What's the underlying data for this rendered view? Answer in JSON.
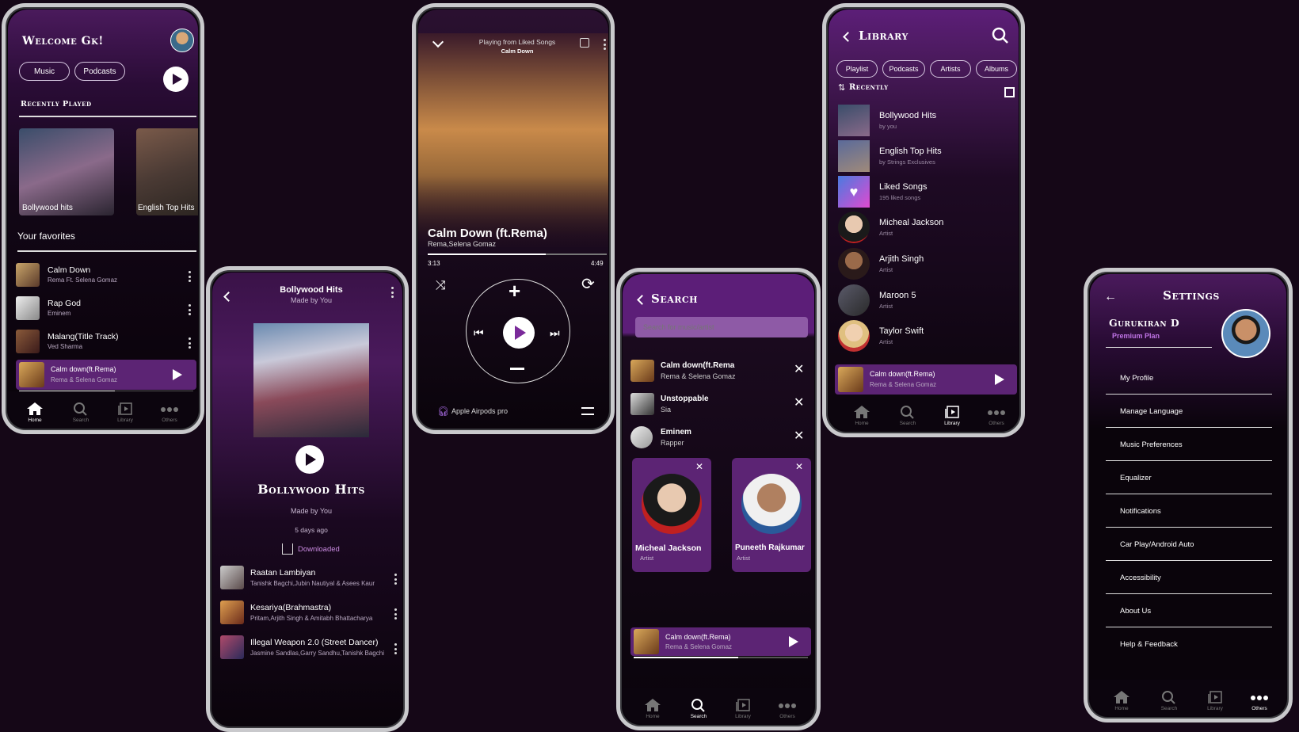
{
  "home": {
    "welcome": "Welcome Gk!",
    "tabs": [
      "Music",
      "Podcasts"
    ],
    "recently_played_label": "Recently Played",
    "recent": [
      {
        "title": "Bollywood hits"
      },
      {
        "title": "English Top Hits"
      }
    ],
    "favorites_label": "Your favorites",
    "favorites": [
      {
        "title": "Calm Down",
        "artist": "Rema Ft. Selena Gomaz"
      },
      {
        "title": "Rap God",
        "artist": "Eminem"
      },
      {
        "title": "Malang(Title Track)",
        "artist": "Ved Sharma"
      }
    ],
    "mini_player": {
      "title": "Calm down(ft.Rema)",
      "artist": "Rema & Selena Gomaz",
      "progress": 0.55
    }
  },
  "nav": [
    {
      "label": "Home",
      "icon": "home-icon"
    },
    {
      "label": "Search",
      "icon": "search-icon"
    },
    {
      "label": "Library",
      "icon": "library-icon"
    },
    {
      "label": "Others",
      "icon": "more-icon"
    }
  ],
  "playlist": {
    "title": "Bollywood Hits",
    "subtitle": "Made by You",
    "heading": "Bollywood Hits",
    "made_by": "Made by You",
    "age": "5 days ago",
    "downloaded": "Downloaded",
    "tracks": [
      {
        "title": "Raatan Lambiyan",
        "artists": "Tanishk Bagchi,Jubin Nautiyal & Asees Kaur"
      },
      {
        "title": "Kesariya(Brahmastra)",
        "artists": "Pritam,Arjith Singh & Amitabh Bhattacharya"
      },
      {
        "title": "Illegal Weapon 2.0 (Street Dancer)",
        "artists": "Jasmine Sandlas,Garry Sandhu,Tanishk Bagchi"
      }
    ]
  },
  "player": {
    "playing_from": "Playing from Liked Songs",
    "now": "Calm Down",
    "title": "Calm Down (ft.Rema)",
    "artist": "Rema,Selena Gomaz",
    "elapsed": "3:13",
    "duration": "4:49",
    "progress": 0.66,
    "device": "Apple Airpods pro"
  },
  "search": {
    "title": "Search",
    "placeholder": "Search for music/artist",
    "recent": [
      {
        "title": "Calm down(ft.Rema",
        "sub": "Rema & Selena Gomaz"
      },
      {
        "title": "Unstoppable",
        "sub": "Sia"
      },
      {
        "title": "Eminem",
        "sub": "Rapper"
      }
    ],
    "artists": [
      {
        "name": "Micheal Jackson",
        "role": "Artist"
      },
      {
        "name": "Puneeth Rajkumar",
        "role": "Artist"
      }
    ],
    "mini_player": {
      "title": "Calm down(ft.Rema)",
      "artist": "Rema & Selena Gomaz",
      "progress": 0.6
    }
  },
  "library": {
    "title": "Library",
    "chips": [
      "Playlist",
      "Podcasts",
      "Artists",
      "Albums"
    ],
    "sort_label": "Recently",
    "items": [
      {
        "title": "Bollywood Hits",
        "sub": "by you"
      },
      {
        "title": "English Top Hits",
        "sub": "by Strings Exclusives"
      },
      {
        "title": "Liked Songs",
        "sub": "195 liked songs"
      },
      {
        "title": "Micheal Jackson",
        "sub": "Artist"
      },
      {
        "title": "Arjith Singh",
        "sub": "Artist"
      },
      {
        "title": "Maroon 5",
        "sub": "Artist"
      },
      {
        "title": "Taylor Swift",
        "sub": "Artist"
      }
    ],
    "mini_player": {
      "title": "Calm down(ft.Rema)",
      "artist": "Rema & Selena Gomaz",
      "progress": 0.6
    }
  },
  "settings": {
    "title": "Settings",
    "user": "Gurukiran D",
    "plan": "Premium Plan",
    "items": [
      "My Profile",
      "Manage Language",
      "Music Preferences",
      "Equalizer",
      "Notifications",
      "Car Play/Android Auto",
      "Accessibility",
      "About Us",
      "Help & Feedback"
    ]
  }
}
